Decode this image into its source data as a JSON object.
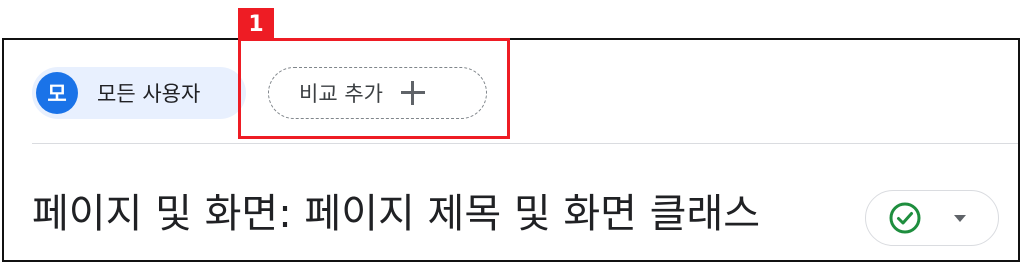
{
  "annotation": {
    "number": "1",
    "color": "#ee1c24"
  },
  "segment": {
    "avatar_letter": "모",
    "label": "모든 사용자",
    "accent": "#1a73e8"
  },
  "compare": {
    "label": "비교 추가",
    "icon": "plus-icon"
  },
  "page": {
    "title": "페이지 및 화면: 페이지 제목 및 화면 클래스"
  },
  "status": {
    "icon": "check-circle-icon",
    "icon_color": "#1e8e3e",
    "menu_icon": "dropdown-arrow-icon"
  }
}
